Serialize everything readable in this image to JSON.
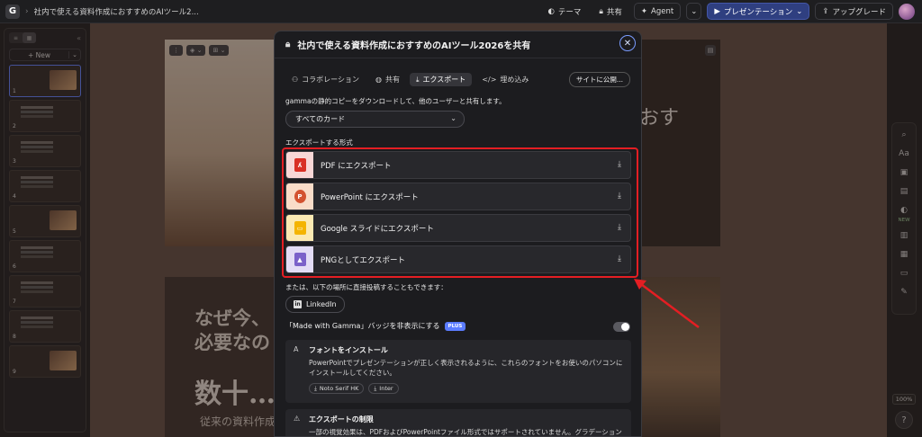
{
  "topbar": {
    "logo": "G",
    "title": "社内で使える資料作成におすすめのAIツール2...",
    "theme_label": "テーマ",
    "share_label": "共有",
    "agent_label": "Agent",
    "present_label": "プレゼンテーション",
    "upgrade_label": "アップグレード"
  },
  "sidepanel": {
    "new_label": "New",
    "thumbs": [
      "1",
      "2",
      "3",
      "4",
      "5",
      "6",
      "7",
      "8",
      "9"
    ]
  },
  "canvas": {
    "slide1_partial": "おす",
    "slide2_heading_line1": "なぜ今、",
    "slide2_heading_line2": "必要なの",
    "slide2_big": "数十…",
    "slide2_para": "従来の資料作成"
  },
  "rail": {
    "zoom": "100%",
    "new_badge": "NEW",
    "help": "?"
  },
  "modal": {
    "title": "社内で使える資料作成におすすめのAIツール2026を共有",
    "tabs": [
      {
        "label": "コラボレーション"
      },
      {
        "label": "共有"
      },
      {
        "label": "エクスポート"
      },
      {
        "label": "埋め込み"
      }
    ],
    "publish_label": "サイトに公開...",
    "description": "gammaの静的コピーをダウンロードして、他のユーザーと共有します。",
    "select_value": "すべてのカード",
    "export_section_label": "エクスポートする形式",
    "export_options": [
      {
        "label": "PDF にエクスポート",
        "icon": "pdf-icon",
        "bg": "#f8d7d6",
        "fg": "#d93025"
      },
      {
        "label": "PowerPoint にエクスポート",
        "icon": "powerpoint-icon",
        "bg": "#f9dcc8",
        "fg": "#d35230"
      },
      {
        "label": "Google スライドにエクスポート",
        "icon": "google-slides-icon",
        "bg": "#fbe9b3",
        "fg": "#f4b400"
      },
      {
        "label": "PNGとしてエクスポート",
        "icon": "image-icon",
        "bg": "#e3dcf5",
        "fg": "#7b61c9"
      }
    ],
    "or_label": "または、以下の場所に直接投稿することもできます：",
    "linkedin_label": "LinkedIn",
    "badge_label": "「Made with Gamma」バッジを非表示にする",
    "plus_label": "PLUS",
    "badge_toggle_on": false,
    "font_info": {
      "title": "フォントをインストール",
      "body": "PowerPointでプレゼンテーションが正しく表示されるように、これらのフォントをお使いのパソコンにインストールしてください。",
      "fonts": [
        "Noto Serif HK",
        "Inter"
      ]
    },
    "limit_info": {
      "title": "エクスポートの制限",
      "body": "一部の視覚効果は、PDFおよびPowerPointファイル形式ではサポートされていません。グラデーション"
    }
  },
  "colors": {
    "accent": "#5b7cff",
    "highlight_red": "#e41e23"
  }
}
